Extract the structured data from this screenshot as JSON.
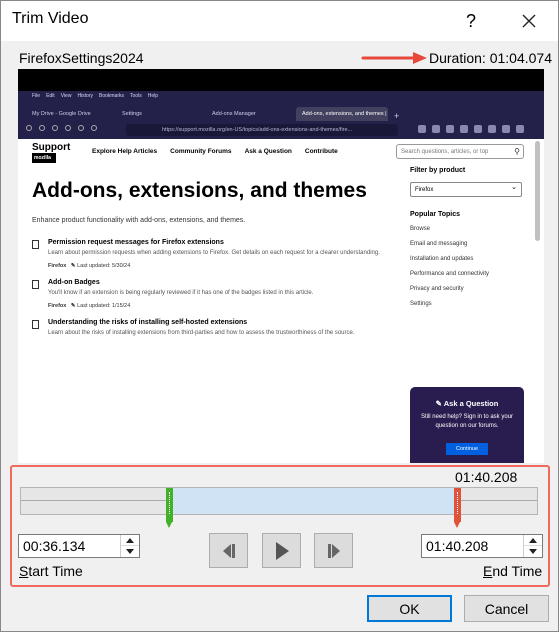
{
  "window": {
    "title": "Trim Video",
    "help_label": "?",
    "file_name": "FirefoxSettings2024",
    "duration_label": "Duration: 01:04.074"
  },
  "video_frame": {
    "browser_menu": [
      "File",
      "Edit",
      "View",
      "History",
      "Bookmarks",
      "Tools",
      "Help"
    ],
    "browser_tabs": [
      {
        "label": "My Drive - Google Drive",
        "active": false
      },
      {
        "label": "Settings",
        "active": false
      },
      {
        "label": "Add-ons Manager",
        "active": false
      },
      {
        "label": "Add-ons, extensions, and themes | Fir...",
        "active": true
      }
    ],
    "url": "https://support.mozilla.org/en-US/topics/add-ons-extensions-and-themes/fire...",
    "site_logo": "Support",
    "site_logo_sub": "mozilla",
    "site_nav": [
      "Explore Help Articles",
      "Community Forums",
      "Ask a Question",
      "Contribute"
    ],
    "search_placeholder": "Search questions, articles, or top",
    "heading": "Add-ons, extensions, and themes",
    "subheading": "Enhance product functionality with add-ons, extensions, and themes.",
    "articles": [
      {
        "title": "Permission request messages for Firefox extensions",
        "desc": "Learn about permission requests when adding extensions to Firefox. Get details on each request for a clearer understanding.",
        "product": "Firefox",
        "updated": "Last updated: 5/30/24"
      },
      {
        "title": "Add-on Badges",
        "desc": "You'll know if an extension is being regularly reviewed if it has one of the badges listed in this article.",
        "product": "Firefox",
        "updated": "Last updated: 1/15/24"
      },
      {
        "title": "Understanding the risks of installing self-hosted extensions",
        "desc": "Learn about the risks of installing extensions from third-parties and how to assess the trustworthiness of the source.",
        "product": "",
        "updated": ""
      }
    ],
    "filter_title": "Filter by product",
    "filter_value": "Firefox",
    "topics_title": "Popular Topics",
    "topics": [
      "Browse",
      "Email and messaging",
      "Installation and updates",
      "Performance and connectivity",
      "Privacy and security",
      "Settings"
    ],
    "help_card": {
      "title": "Ask a Question",
      "text": "Still need help? Sign in to ask your question on our forums.",
      "button": "Continue"
    }
  },
  "trim": {
    "end_marker_label": "01:40.208",
    "start_position_pct": 28.6,
    "end_position_pct": 84.4,
    "start_time": "00:36.134",
    "end_time": "01:40.208",
    "start_label_underlined": "S",
    "start_label_rest": "tart Time",
    "end_label_underlined": "E",
    "end_label_rest": "nd Time"
  },
  "buttons": {
    "ok": "OK",
    "cancel": "Cancel"
  },
  "colors": {
    "highlight": "#f06a5e",
    "start_handle": "#43b02a",
    "end_handle": "#e0533b",
    "selection": "#cfe3f5"
  }
}
